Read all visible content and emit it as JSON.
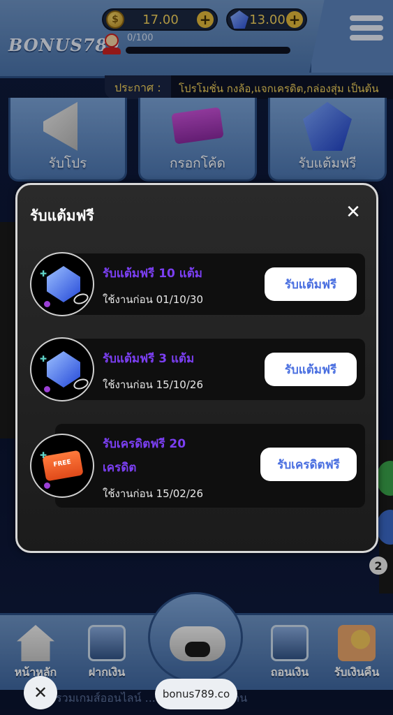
{
  "header": {
    "logo": "BONUS789",
    "coins": "17.00",
    "gems": "13.00",
    "progress_label": "0/100",
    "progress_fraction": 0.0,
    "plus": "+"
  },
  "announcement": {
    "tag": "ประกาศ :",
    "text": "โปรโมชั่น กงล้อ,แจกเครดิต,กล่องสุ่ม เป็นต้น"
  },
  "promo_tiles": [
    {
      "label": "รับโปร",
      "icon": "megaphone-icon"
    },
    {
      "label": "กรอกโค้ด",
      "icon": "code-ticket-icon"
    },
    {
      "label": "รับแต้มฟรี",
      "icon": "gem-icon"
    }
  ],
  "modal": {
    "title": "รับแต้มฟรี",
    "close": "✕",
    "rewards": [
      {
        "title": "รับแต้มฟรี 10 แต้ม",
        "expiry": "ใช้งานก่อน 01/10/30",
        "button": "รับแต้มฟรี",
        "icon": "gem-icon"
      },
      {
        "title": "รับแต้มฟรี 3 แต้ม",
        "expiry": "ใช้งานก่อน 15/10/26",
        "button": "รับแต้มฟรี",
        "icon": "gem-icon"
      },
      {
        "title_line1": "รับเครดิตฟรี 20",
        "title_line2": "เครดิต",
        "expiry": "ใช้งานก่อน 15/02/26",
        "button": "รับเครดิตฟรี",
        "icon": "free-credit-card-icon",
        "card_text": "FREE"
      }
    ]
  },
  "side": {
    "badge": "2"
  },
  "bottom_nav": [
    {
      "label": "หน้าหลัก",
      "icon": "house-icon"
    },
    {
      "label": "ฝากเงิน",
      "icon": "atm-deposit-icon"
    },
    {
      "label": "ถอนเงิน",
      "icon": "atm-withdraw-icon"
    },
    {
      "label": "รับเงินคืน",
      "icon": "cashback-hand-icon"
    }
  ],
  "footer_text": "รวมเกมส์ออนไลน์ ... มากกว่าในทุกด้าน",
  "browser": {
    "close": "✕",
    "url": "bonus789.co"
  },
  "colors": {
    "accent": "#7b3ff2",
    "button_text": "#4a6fe0",
    "gold": "#f3d25c"
  }
}
